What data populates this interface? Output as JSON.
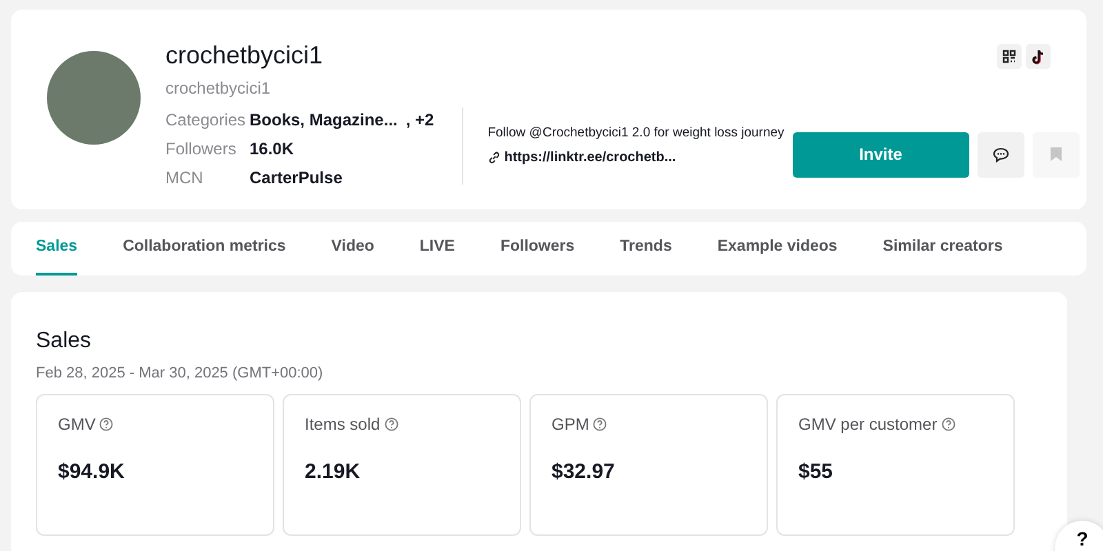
{
  "profile": {
    "display_name": "crochetbycici1",
    "username": "crochetbycici1",
    "details": [
      {
        "label": "Categories",
        "value": "Books, Magazine...",
        "extra": ", +2"
      },
      {
        "label": "Followers",
        "value": "16.0K"
      },
      {
        "label": "MCN",
        "value": "CarterPulse"
      }
    ],
    "bio": "Follow @Crochetbycici1 2.0 for weight loss journey",
    "link": "https://linktr.ee/crochetb...",
    "invite_button": "Invite",
    "saved": false
  },
  "tabs": [
    {
      "label": "Sales",
      "selected": true
    },
    {
      "label": "Collaboration metrics",
      "selected": false
    },
    {
      "label": "Video",
      "selected": false
    },
    {
      "label": "LIVE",
      "selected": false
    },
    {
      "label": "Followers",
      "selected": false
    },
    {
      "label": "Trends",
      "selected": false
    },
    {
      "label": "Example videos",
      "selected": false
    },
    {
      "label": "Similar creators",
      "selected": false
    }
  ],
  "sales": {
    "title": "Sales",
    "date_range": "Feb 28, 2025 - Mar 30, 2025 (GMT+00:00)",
    "metrics": [
      {
        "label": "GMV",
        "value": "$94.9K"
      },
      {
        "label": "Items sold",
        "value": "2.19K"
      },
      {
        "label": "GPM",
        "value": "$32.97"
      },
      {
        "label": "GMV per customer",
        "value": "$55"
      }
    ]
  },
  "help_button": "?"
}
